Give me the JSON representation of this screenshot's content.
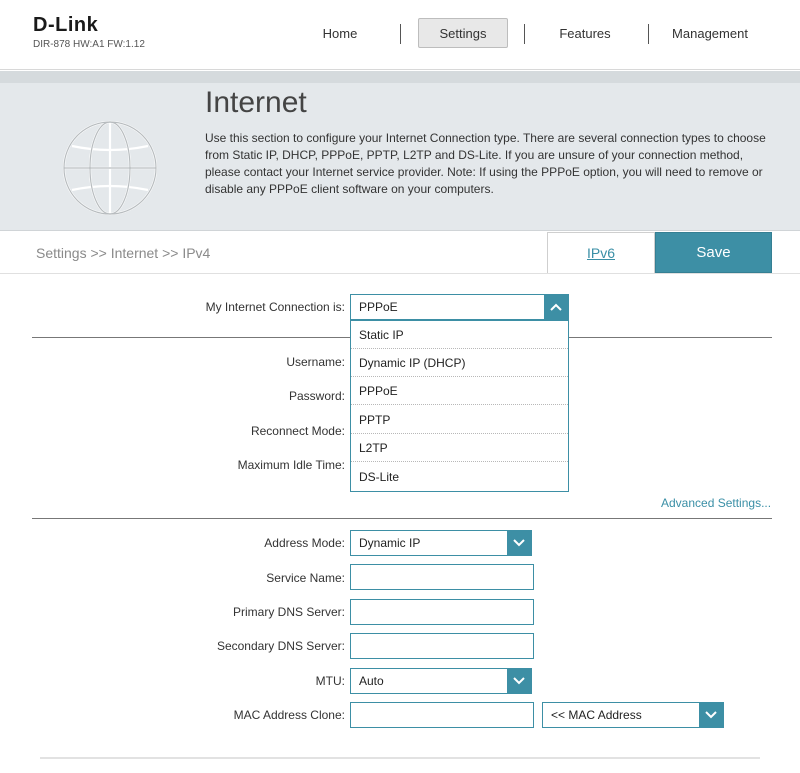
{
  "header": {
    "logo": "D-Link",
    "device_info": "DIR-878 HW:A1 FW:1.12",
    "nav": {
      "home": "Home",
      "settings": "Settings",
      "features": "Features",
      "management": "Management"
    }
  },
  "banner": {
    "title": "Internet",
    "description": "Use this section to configure your Internet Connection type. There are several connection types to choose from Static IP, DHCP, PPPoE, PPTP, L2TP and DS-Lite. If you are unsure of your connection method, please contact your Internet service provider. Note: If using the PPPoE option, you will need to remove or disable any PPPoE client software on your computers.",
    "icon": "globe-icon"
  },
  "breadcrumb": "Settings >> Internet >> IPv4",
  "actions": {
    "ipv6": "IPv6",
    "save": "Save"
  },
  "connection": {
    "label": "My Internet Connection is:",
    "value": "PPPoE",
    "options": [
      "Static IP",
      "Dynamic IP (DHCP)",
      "PPPoE",
      "PPTP",
      "L2TP",
      "DS-Lite"
    ]
  },
  "pppoe_fields": {
    "username": "Username:",
    "password": "Password:",
    "reconnect_mode": "Reconnect Mode:",
    "max_idle_time": "Maximum Idle Time:"
  },
  "advanced_settings": "Advanced Settings...",
  "advanced": {
    "address_mode_label": "Address Mode:",
    "address_mode_value": "Dynamic IP",
    "service_name_label": "Service Name:",
    "primary_dns_label": "Primary DNS Server:",
    "secondary_dns_label": "Secondary DNS Server:",
    "mtu_label": "MTU:",
    "mtu_value": "Auto",
    "mac_clone_label": "MAC Address Clone:",
    "mac_select_value": "<< MAC Address"
  },
  "colors": {
    "accent": "#3d8fa5",
    "banner_bg": "#e4e8eb"
  }
}
